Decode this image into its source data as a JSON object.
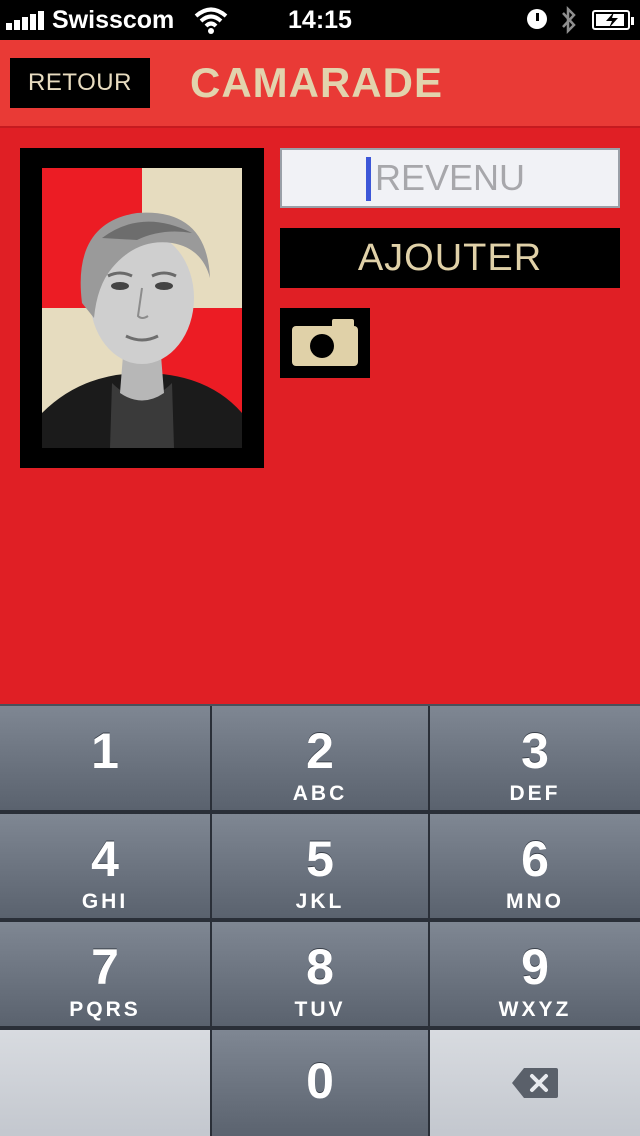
{
  "status_bar": {
    "carrier": "Swisscom",
    "time": "14:15",
    "icons": [
      "signal-icon",
      "wifi-icon",
      "clock-icon",
      "bluetooth-icon",
      "battery-charging-icon"
    ]
  },
  "nav": {
    "back_label": "RETOUR",
    "title": "CAMARADE"
  },
  "form": {
    "income_placeholder": "REVENU",
    "income_value": "",
    "add_label": "AJOUTER",
    "camera_icon": "camera-icon"
  },
  "keypad": {
    "keys": [
      {
        "num": "1",
        "letters": ""
      },
      {
        "num": "2",
        "letters": "ABC"
      },
      {
        "num": "3",
        "letters": "DEF"
      },
      {
        "num": "4",
        "letters": "GHI"
      },
      {
        "num": "5",
        "letters": "JKL"
      },
      {
        "num": "6",
        "letters": "MNO"
      },
      {
        "num": "7",
        "letters": "PQRS"
      },
      {
        "num": "8",
        "letters": "TUV"
      },
      {
        "num": "9",
        "letters": "WXYZ"
      },
      {
        "num": "0",
        "letters": ""
      }
    ],
    "delete_icon": "backspace-icon"
  },
  "colors": {
    "background": "#e01f25",
    "navbar": "#e93a36",
    "accent_text": "#e2d3ad",
    "button": "#000000",
    "caret": "#3d57d8"
  }
}
